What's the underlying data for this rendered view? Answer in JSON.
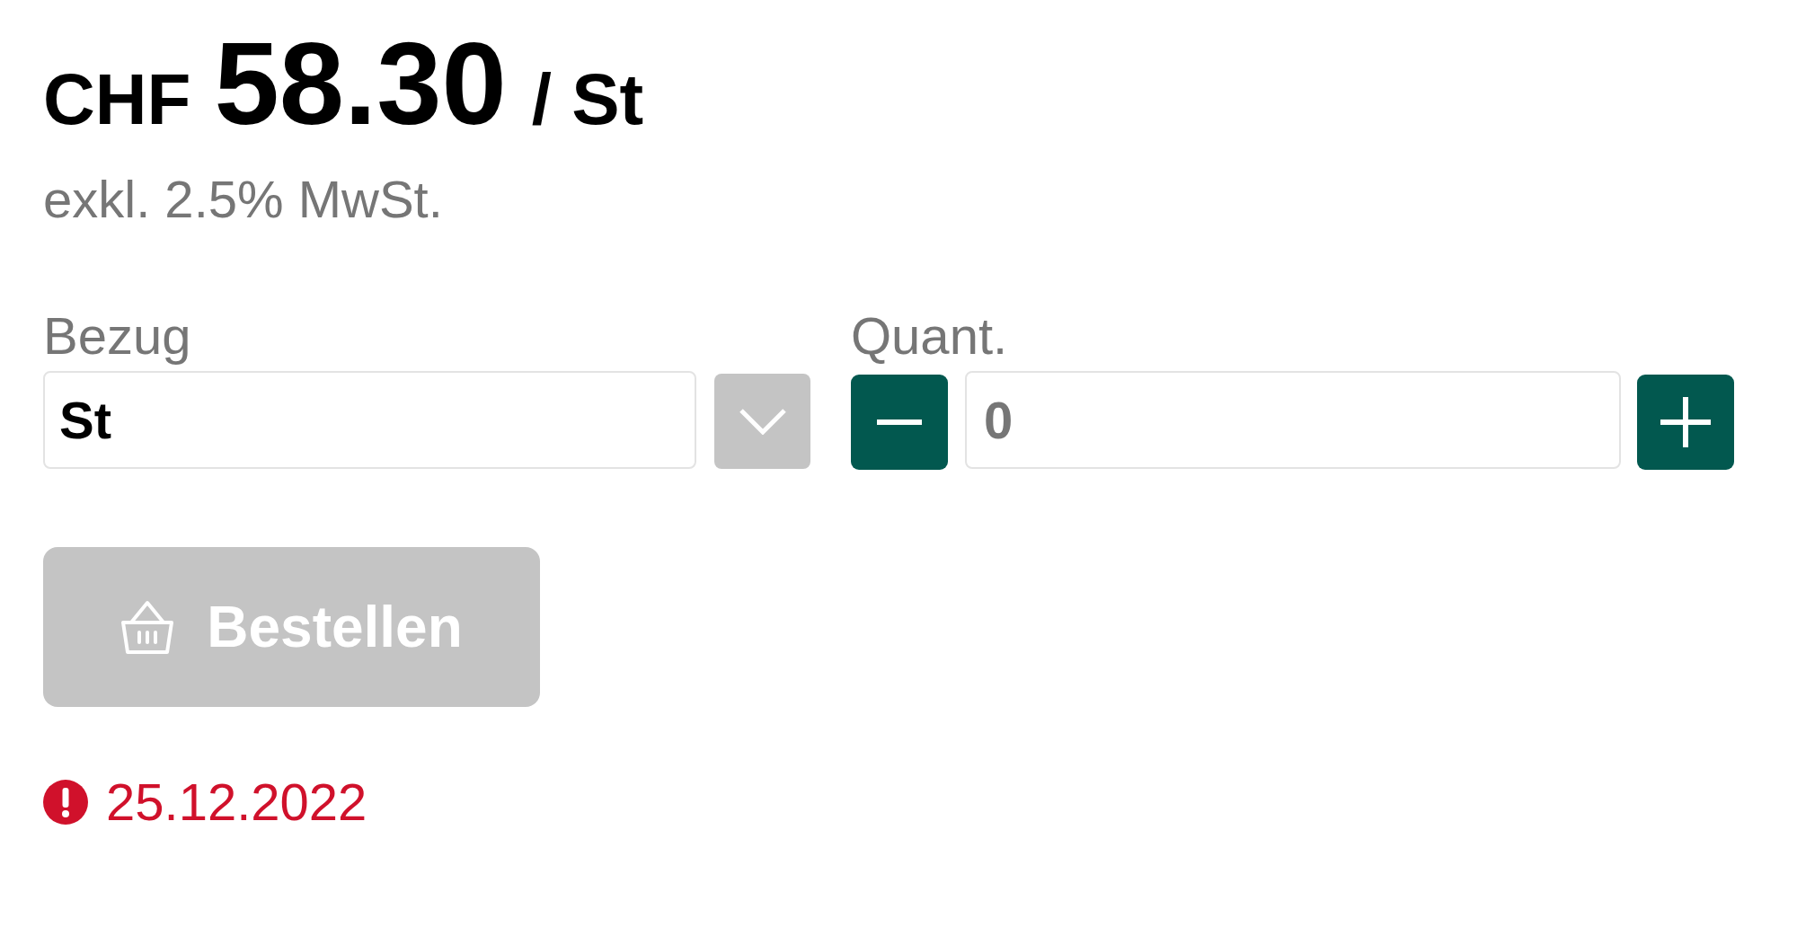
{
  "price": {
    "currency": "CHF",
    "amount": "58.30",
    "unit": "/ St"
  },
  "tax_note": "exkl. 2.5% MwSt.",
  "unit_select": {
    "label": "Bezug",
    "value": "St"
  },
  "quantity": {
    "label": "Quant.",
    "value": "0"
  },
  "order_button": {
    "label": "Bestellen",
    "disabled": true
  },
  "availability": {
    "date": "25.12.2022"
  }
}
